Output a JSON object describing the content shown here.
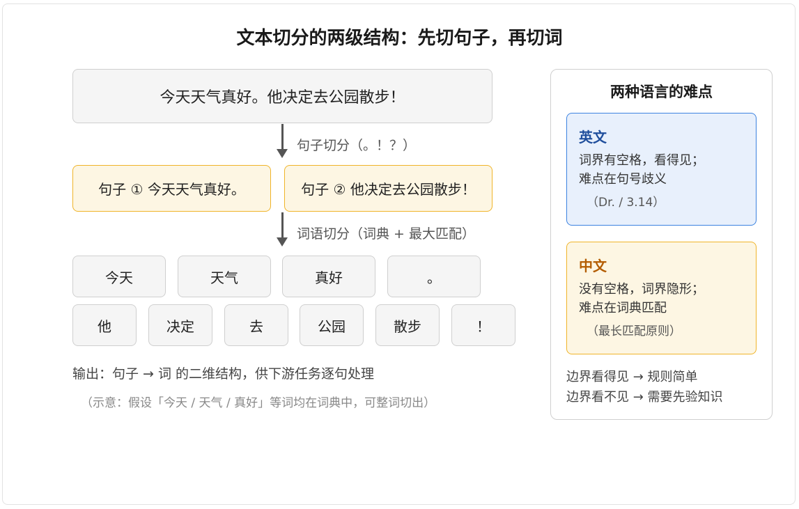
{
  "title": "文本切分的两级结构：先切句子，再切词",
  "input_text": "今天天气真好。他决定去公园散步！",
  "step1_label": "句子切分（。！？）",
  "sentences": [
    "句子 ① 今天天气真好。",
    "句子 ② 他决定去公园散步！"
  ],
  "step2_label": "词语切分（词典 + 最大匹配）",
  "words_row1": [
    "今天",
    "天气",
    "真好",
    "。"
  ],
  "words_row2": [
    "他",
    "决定",
    "去",
    "公园",
    "散步",
    "！"
  ],
  "output": "输出：句子 → 词 的二维结构，供下游任务逐句处理",
  "note": "（示意：假设「今天 / 天气 / 真好」等词均在词典中，可整词切出）",
  "side": {
    "title": "两种语言的难点",
    "english": {
      "heading": "英文",
      "line1": "词界有空格，看得见；",
      "line2": "难点在句号歧义",
      "sub": "（Dr. / 3.14）"
    },
    "chinese": {
      "heading": "中文",
      "line1": "没有空格，词界隐形；",
      "line2": "难点在词典匹配",
      "sub": "（最长匹配原则）"
    },
    "foot1": "边界看得见 → 规则简单",
    "foot2": "边界看不见 → 需要先验知识"
  },
  "colors": {
    "sentence_border": "#f0b429",
    "sentence_fill": "#fdf6e3",
    "english_border": "#3b82e0",
    "english_fill": "#e8f0fc",
    "word_fill": "#f5f5f5"
  }
}
